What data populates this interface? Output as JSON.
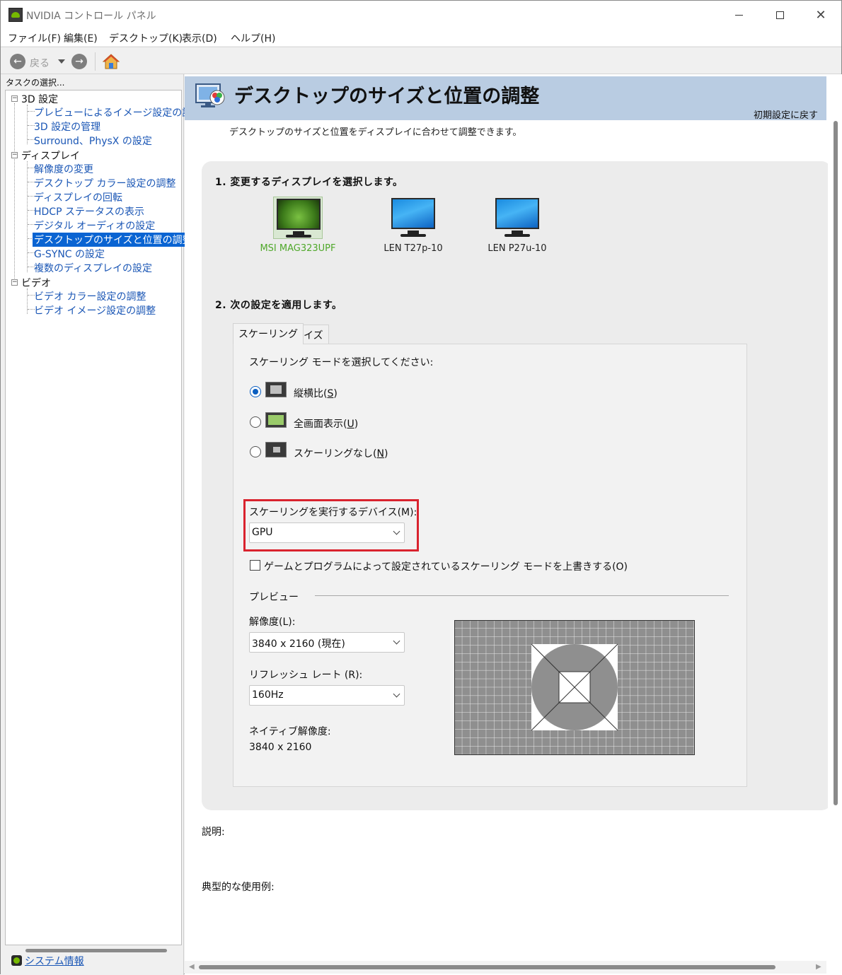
{
  "window": {
    "title": "NVIDIA コントロール パネル"
  },
  "menu": [
    "ファイル(F)",
    "編集(E)",
    "デスクトップ(K)",
    "表示(D)",
    "ヘルプ(H)"
  ],
  "toolbar": {
    "back_label": "戻る"
  },
  "left_pane": {
    "task_label": "タスクの選択...",
    "tree": {
      "cat_3d": "3D 設定",
      "cat_3d_items": [
        "プレビューによるイメージ設定の調整",
        "3D 設定の管理",
        "Surround、PhysX の設定"
      ],
      "cat_display": "ディスプレイ",
      "cat_display_items": [
        "解像度の変更",
        "デスクトップ カラー設定の調整",
        "ディスプレイの回転",
        "HDCP ステータスの表示",
        "デジタル オーディオの設定",
        "デスクトップのサイズと位置の調整",
        "G-SYNC の設定",
        "複数のディスプレイの設定"
      ],
      "cat_video": "ビデオ",
      "cat_video_items": [
        "ビデオ カラー設定の調整",
        "ビデオ イメージ設定の調整"
      ]
    },
    "selected_item": "デスクトップのサイズと位置の調整",
    "system_info": "システム情報"
  },
  "page": {
    "title": "デスクトップのサイズと位置の調整",
    "restore_defaults": "初期設定に戻す",
    "description": "デスクトップのサイズと位置をディスプレイに合わせて調整できます。",
    "step1": "1. 変更するディスプレイを選択します。",
    "monitors": [
      {
        "label": "MSI MAG323UPF",
        "selected": true
      },
      {
        "label": "LEN T27p-10",
        "selected": false
      },
      {
        "label": "LEN P27u-10",
        "selected": false
      }
    ],
    "step2": "2. 次の設定を適用します。",
    "tabs": [
      "スケーリング",
      "サイズ"
    ],
    "active_tab": "スケーリング",
    "scaling_mode_label": "スケーリング モードを選択してください:",
    "scaling_modes": [
      {
        "label": "縦横比(",
        "key": "S",
        "suffix": ")",
        "checked": true
      },
      {
        "label": "全画面表示(",
        "key": "U",
        "suffix": ")",
        "checked": false
      },
      {
        "label": "スケーリングなし(",
        "key": "N",
        "suffix": ")",
        "checked": false
      }
    ],
    "device_label": "スケーリングを実行するデバイス(M):",
    "device_value": "GPU",
    "override_checkbox": "ゲームとプログラムによって設定されているスケーリング モードを上書きする(O)",
    "override_checked": false,
    "preview_label": "プレビュー",
    "resolution_label": "解像度(L):",
    "resolution_value": "3840 x 2160 (現在)",
    "refresh_label": "リフレッシュ レート (R):",
    "refresh_value": "160Hz",
    "native_label": "ネイティブ解像度:",
    "native_value": "3840 x 2160",
    "explain_label": "説明:",
    "usage_label": "典型的な使用例:"
  },
  "colors": {
    "nvidia_green": "#76b900",
    "selection_blue": "#0a64d2",
    "highlight_red": "#d9232e",
    "banner": "#b9cce2"
  }
}
